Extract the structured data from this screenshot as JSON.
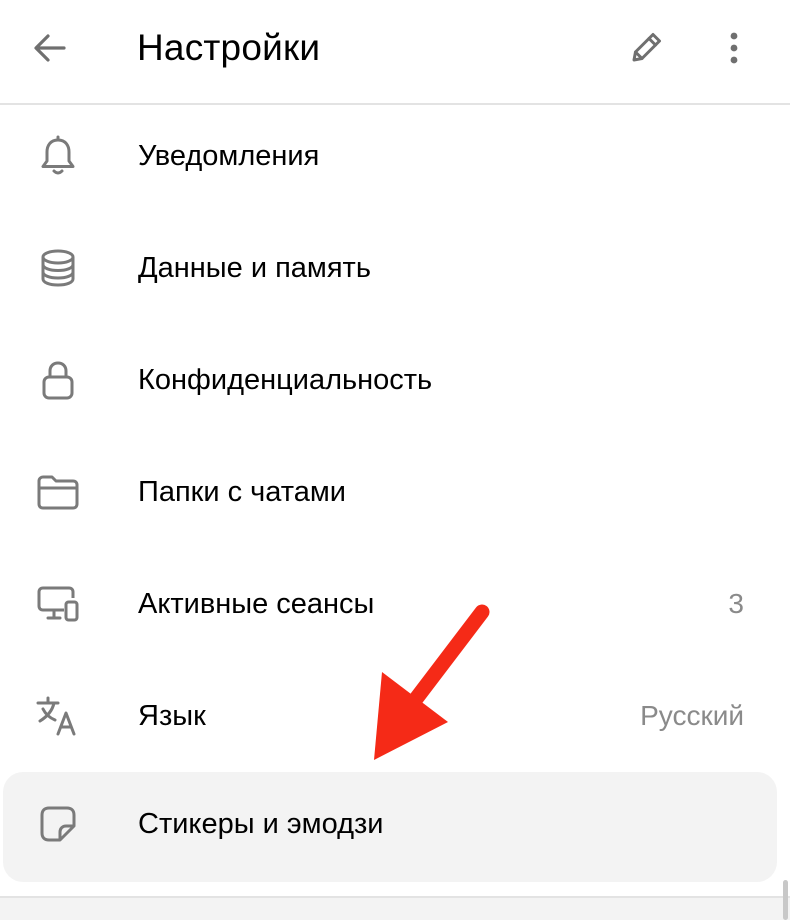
{
  "header": {
    "title": "Настройки",
    "back_icon": "arrow-left-icon",
    "edit_icon": "pencil-icon",
    "more_icon": "more-vertical-icon"
  },
  "menu": {
    "items": [
      {
        "label": "Уведомления",
        "value": "",
        "icon": "bell-icon"
      },
      {
        "label": "Данные и память",
        "value": "",
        "icon": "database-icon"
      },
      {
        "label": "Конфиденциальность",
        "value": "",
        "icon": "lock-icon"
      },
      {
        "label": "Папки с чатами",
        "value": "",
        "icon": "folder-icon"
      },
      {
        "label": "Активные сеансы",
        "value": "3",
        "icon": "devices-icon"
      },
      {
        "label": "Язык",
        "value": "Русский",
        "icon": "translate-icon"
      },
      {
        "label": "Стикеры и эмодзи",
        "value": "",
        "icon": "sticker-icon"
      }
    ],
    "selected_index": 6
  },
  "colors": {
    "text": "#000000",
    "secondary_text": "#8a8a8a",
    "icon": "#7a7a7a",
    "selected_bg": "#f3f3f3",
    "divider": "#e3e3e3",
    "annotation_arrow": "#f52a17"
  }
}
